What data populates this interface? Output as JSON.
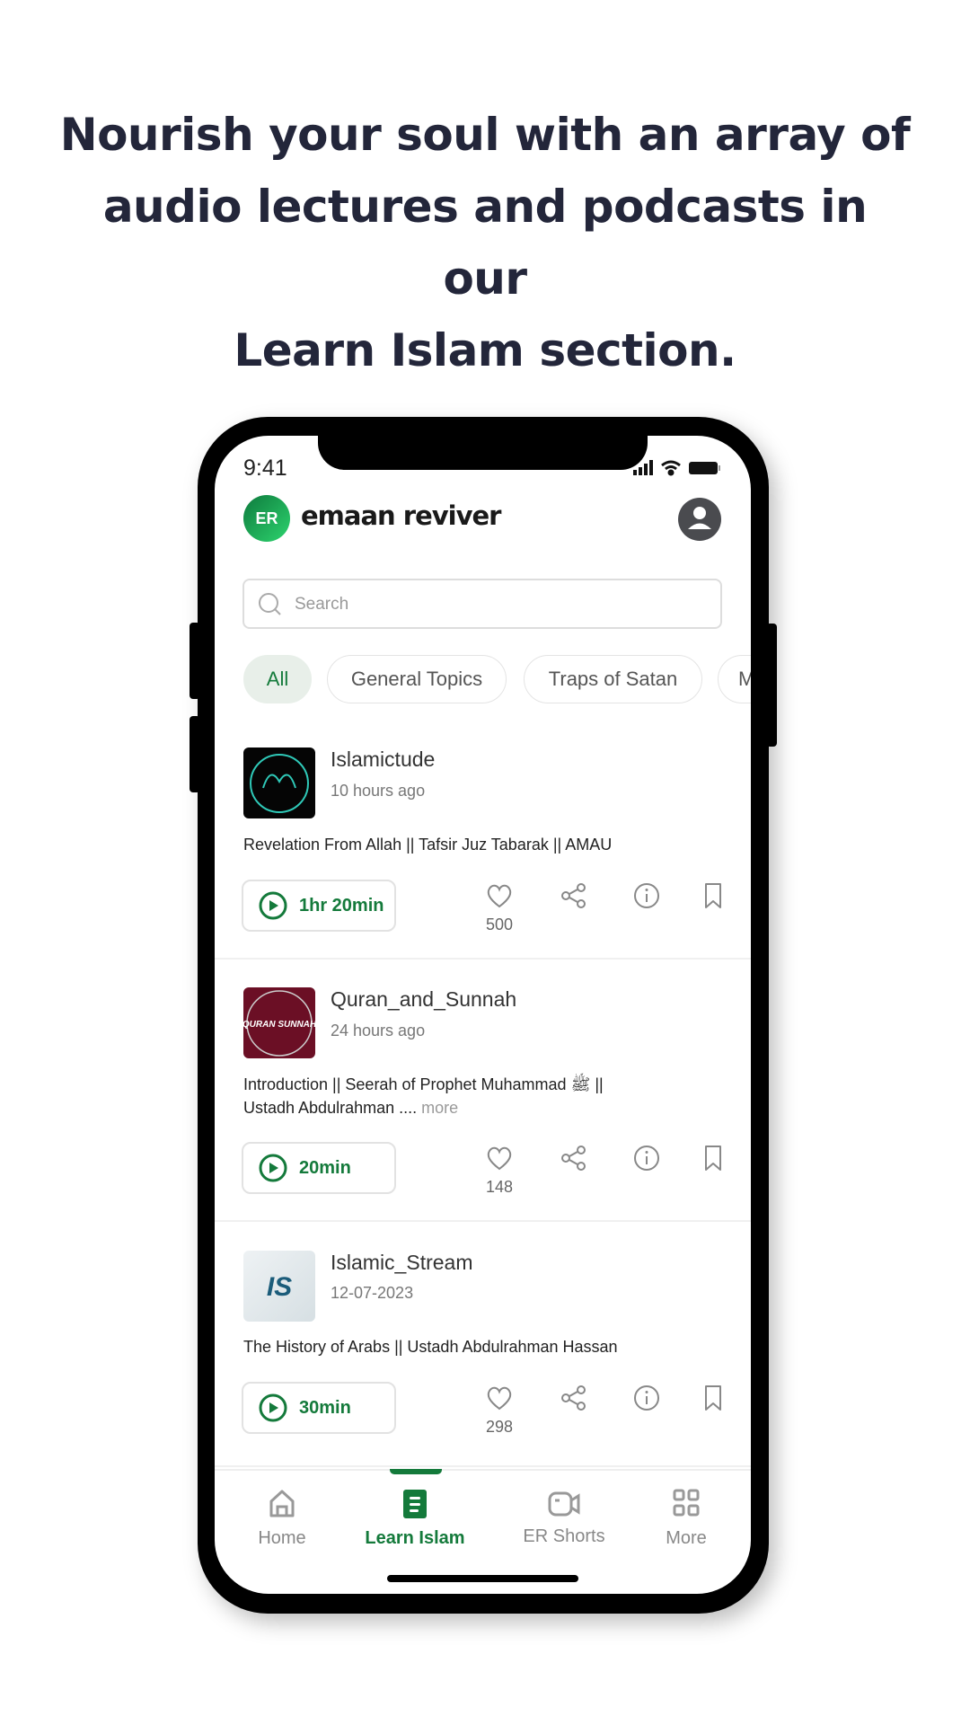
{
  "headline": [
    "Nourish your soul with an array of",
    "audio lectures and podcasts in our",
    "Learn Islam section."
  ],
  "status_bar": {
    "time": "9:41"
  },
  "app": {
    "brand": "emaan reviver",
    "logo_text": "ER"
  },
  "search": {
    "placeholder": "Search"
  },
  "chips": [
    {
      "label": "All",
      "active": true
    },
    {
      "label": "General Topics"
    },
    {
      "label": "Traps of Satan"
    },
    {
      "label": "M"
    }
  ],
  "posts": [
    {
      "channel": "Islamictude",
      "time": "10 hours ago",
      "title": "Revelation From Allah || Tafsir Juz Tabarak || AMAU",
      "title_line2": "",
      "more": "",
      "duration": "1hr 20min",
      "likes": "500"
    },
    {
      "channel": "Quran_and_Sunnah",
      "time": "24 hours ago",
      "title": "Introduction || Seerah of Prophet Muhammad ﷺ ||",
      "title_line2": "Ustadh Abdulrahman ....",
      "more": "more",
      "duration": "20min",
      "likes": "148",
      "thumb_text": "QURAN SUNNAH"
    },
    {
      "channel": "Islamic_Stream",
      "time": "12-07-2023",
      "title": "The History of Arabs || Ustadh Abdulrahman Hassan",
      "title_line2": "",
      "more": "",
      "duration": "30min",
      "likes": "298",
      "thumb_text": "IS"
    }
  ],
  "nav": [
    {
      "label": "Home",
      "icon": "home-icon"
    },
    {
      "label": "Learn Islam",
      "icon": "document-icon",
      "active": true
    },
    {
      "label": "ER Shorts",
      "icon": "video-icon"
    },
    {
      "label": "More",
      "icon": "grid-icon"
    }
  ],
  "colors": {
    "accent": "#147a3b",
    "headline": "#23263a"
  }
}
